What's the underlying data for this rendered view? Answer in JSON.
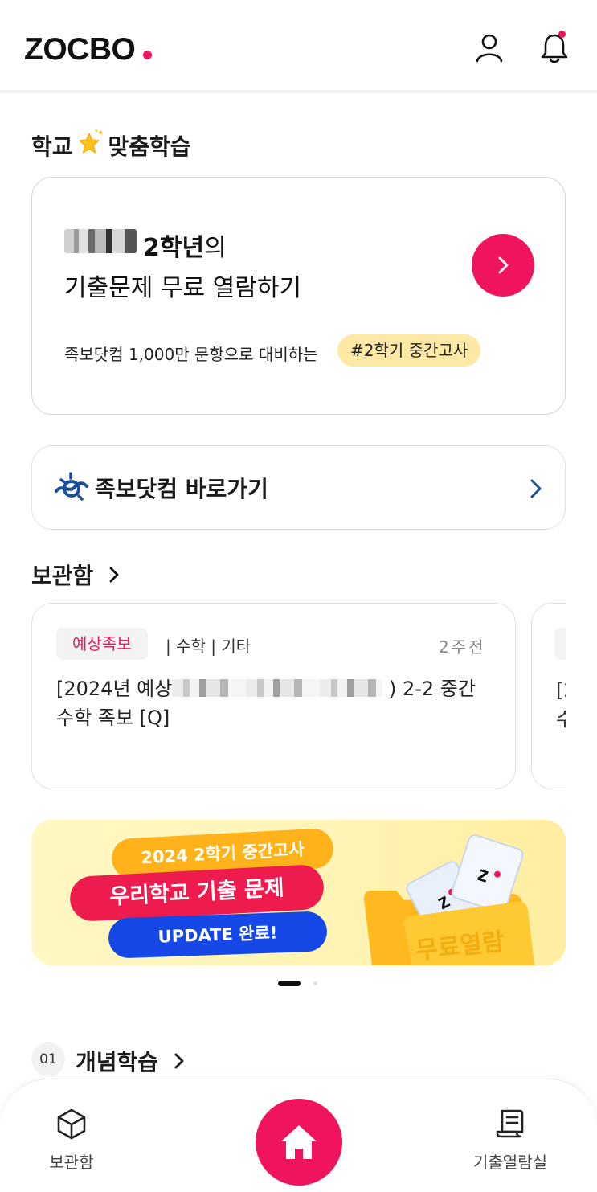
{
  "header": {
    "logo": "ZOCBO",
    "accent_color": "#f0135e",
    "user_icon": "user-icon",
    "bell_icon": "bell-icon"
  },
  "school_section": {
    "title_part1": "학교",
    "title_part2": "맞춤학습",
    "card": {
      "grade": "2학년",
      "grade_suffix": "의",
      "line2": "기출문제 무료 열람하기",
      "desc": "족보닷컴 1,000만 문항으로 대비하는",
      "tag": "#2학기 중간고사"
    }
  },
  "jokbo_link": {
    "label": "족보닷컴 바로가기"
  },
  "storage": {
    "title": "보관함",
    "items": [
      {
        "tag": "예상족보",
        "meta": "| 수학 | 기타",
        "time": "2주전",
        "title_start": "[2024년 예상",
        "title_mid": ") 2-2 중간",
        "title_end": "수학 족보 [Q]"
      }
    ],
    "peek_text_1": "[2",
    "peek_text_2": "수"
  },
  "banner": {
    "line1": "2024 2학기 중간고사",
    "line2": "우리학교 기출 문제",
    "line3": "UPDATE 완료!",
    "folder_text": "무료열람"
  },
  "concept": {
    "number": "01",
    "title": "개념학습"
  },
  "bottom_nav": {
    "store_label": "보관함",
    "exam_label": "기출열람실"
  }
}
